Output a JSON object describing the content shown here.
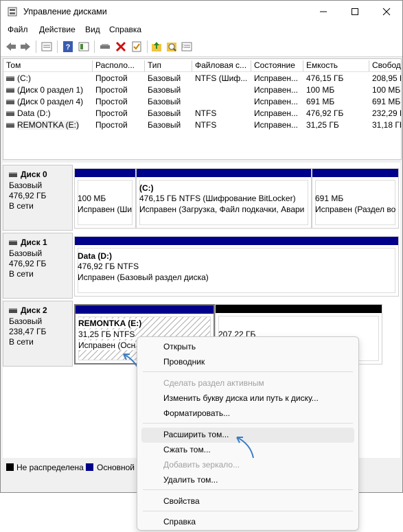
{
  "window": {
    "title": "Управление дисками"
  },
  "menu": [
    "Файл",
    "Действие",
    "Вид",
    "Справка"
  ],
  "toolbar_icons": [
    "back-arrow-icon",
    "forward-arrow-icon",
    "properties-icon",
    "help-icon",
    "panel-icon",
    "connect-icon",
    "delete-icon",
    "check-icon",
    "folder-up-icon",
    "search-icon",
    "list-icon"
  ],
  "volume_columns": [
    "Том",
    "Располо...",
    "Тип",
    "Файловая с...",
    "Состояние",
    "Емкость",
    "Свобод"
  ],
  "volumes": [
    {
      "name": "(C:)",
      "layout": "Простой",
      "type": "Базовый",
      "fs": "NTFS (Шиф...",
      "status": "Исправен...",
      "capacity": "476,15 ГБ",
      "free": "208,95 Г"
    },
    {
      "name": "(Диск 0 раздел 1)",
      "layout": "Простой",
      "type": "Базовый",
      "fs": "",
      "status": "Исправен...",
      "capacity": "100 МБ",
      "free": "100 МБ"
    },
    {
      "name": "(Диск 0 раздел 4)",
      "layout": "Простой",
      "type": "Базовый",
      "fs": "",
      "status": "Исправен...",
      "capacity": "691 МБ",
      "free": "691 МБ"
    },
    {
      "name": "Data (D:)",
      "layout": "Простой",
      "type": "Базовый",
      "fs": "NTFS",
      "status": "Исправен...",
      "capacity": "476,92 ГБ",
      "free": "232,29 Г"
    },
    {
      "name": "REMONTKA (E:)",
      "layout": "Простой",
      "type": "Базовый",
      "fs": "NTFS",
      "status": "Исправен...",
      "capacity": "31,25 ГБ",
      "free": "31,18 ГБ"
    }
  ],
  "disks": [
    {
      "name": "Диск 0",
      "type": "Базовый",
      "size": "476,92 ГБ",
      "state": "В сети",
      "parts": [
        {
          "title": "",
          "line1": "100 МБ",
          "line2": "Исправен (Ши"
        },
        {
          "title": "(C:)",
          "line1": "476,15 ГБ NTFS (Шифрование BitLocker)",
          "line2": "Исправен (Загрузка, Файл подкачки, Авари"
        },
        {
          "title": "",
          "line1": "691 МБ",
          "line2": "Исправен (Раздел во"
        }
      ]
    },
    {
      "name": "Диск 1",
      "type": "Базовый",
      "size": "476,92 ГБ",
      "state": "В сети",
      "parts": [
        {
          "title": "Data (D:)",
          "line1": "476,92 ГБ NTFS",
          "line2": "Исправен (Базовый раздел диска)"
        }
      ]
    },
    {
      "name": "Диск 2",
      "type": "Базовый",
      "size": "238,47 ГБ",
      "state": "В сети",
      "parts": [
        {
          "title": "REMONTKA (E:)",
          "line1": "31,25 ГБ NTFS",
          "line2": "Исправен (Осн"
        },
        {
          "title": "",
          "line1": "207,22 ГБ",
          "line2": ""
        }
      ]
    }
  ],
  "legend": [
    {
      "label": "Не распределена",
      "color": "#000000"
    },
    {
      "label": "Основной",
      "color": "#00008b"
    }
  ],
  "context_menu": [
    {
      "label": "Открыть",
      "enabled": true
    },
    {
      "label": "Проводник",
      "enabled": true
    },
    {
      "label": "Сделать раздел активным",
      "enabled": false
    },
    {
      "label": "Изменить букву диска или путь к диску...",
      "enabled": true
    },
    {
      "label": "Форматировать...",
      "enabled": true
    },
    {
      "label": "Расширить том...",
      "enabled": true,
      "highlighted": true
    },
    {
      "label": "Сжать том...",
      "enabled": true
    },
    {
      "label": "Добавить зеркало...",
      "enabled": false
    },
    {
      "label": "Удалить том...",
      "enabled": true
    },
    {
      "label": "Свойства",
      "enabled": true
    },
    {
      "label": "Справка",
      "enabled": true
    }
  ],
  "colors": {
    "primary_partition": "#00008b",
    "unallocated": "#000000",
    "arrow": "#3b7fc4"
  }
}
